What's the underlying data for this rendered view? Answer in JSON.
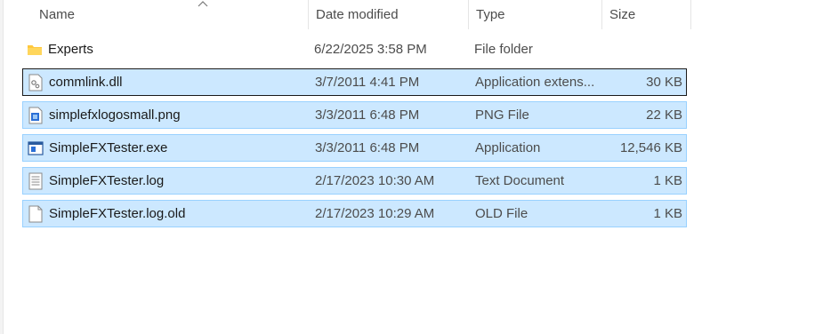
{
  "columns": {
    "name": "Name",
    "date": "Date modified",
    "type": "Type",
    "size": "Size"
  },
  "files": [
    {
      "name": "Experts",
      "date": "6/22/2025 3:58 PM",
      "type": "File folder",
      "size": "",
      "icon": "folder-icon",
      "selected": false
    },
    {
      "name": "commlink.dll",
      "date": "3/7/2011 4:41 PM",
      "type": "Application extens...",
      "size": "30 KB",
      "icon": "dll-file-icon",
      "selected": true
    },
    {
      "name": "simplefxlogosmall.png",
      "date": "3/3/2011 6:48 PM",
      "type": "PNG File",
      "size": "22 KB",
      "icon": "image-file-icon",
      "selected": true
    },
    {
      "name": "SimpleFXTester.exe",
      "date": "3/3/2011 6:48 PM",
      "type": "Application",
      "size": "12,546 KB",
      "icon": "exe-file-icon",
      "selected": true
    },
    {
      "name": "SimpleFXTester.log",
      "date": "2/17/2023 10:30 AM",
      "type": "Text Document",
      "size": "1 KB",
      "icon": "text-file-icon",
      "selected": true
    },
    {
      "name": "SimpleFXTester.log.old",
      "date": "2/17/2023 10:29 AM",
      "type": "OLD File",
      "size": "1 KB",
      "icon": "blank-file-icon",
      "selected": true
    }
  ],
  "colors": {
    "selection_fill": "#cce8ff",
    "selection_border": "#99d1ff",
    "folder": "#ffc83d"
  }
}
